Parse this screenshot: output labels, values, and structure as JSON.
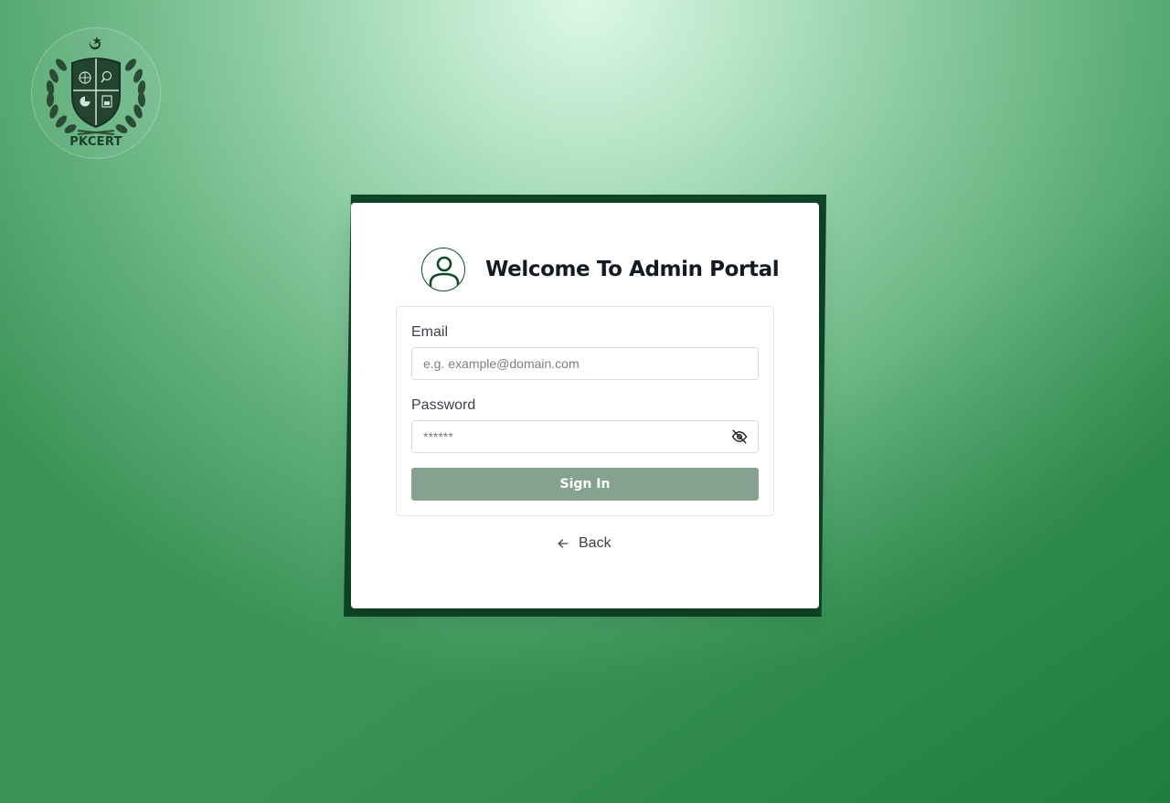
{
  "branding": {
    "logo_text": "PKCERT",
    "primary_color": "#0e4a27",
    "button_color": "#84a28f"
  },
  "login": {
    "title": "Welcome To Admin Portal",
    "avatar_icon": "user-icon",
    "email": {
      "label": "Email",
      "placeholder": "e.g. example@domain.com",
      "value": ""
    },
    "password": {
      "label": "Password",
      "placeholder": "******",
      "value": "",
      "toggle_icon": "eye-off-icon"
    },
    "submit_label": "Sign In",
    "back": {
      "label": "Back",
      "icon": "arrow-left-icon"
    }
  }
}
